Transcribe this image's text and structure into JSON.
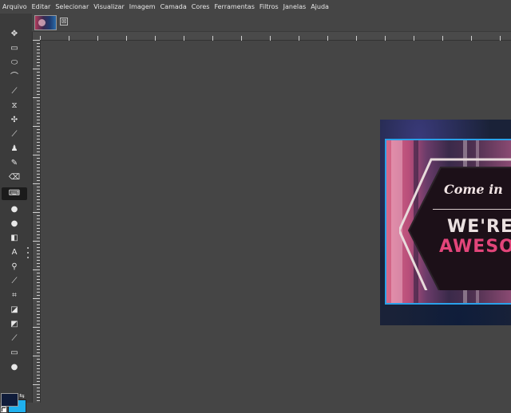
{
  "menubar": {
    "items": [
      "Arquivo",
      "Editar",
      "Selecionar",
      "Visualizar",
      "Imagem",
      "Camada",
      "Cores",
      "Ferramentas",
      "Filtros",
      "Janelas",
      "Ajuda"
    ]
  },
  "toolbox": {
    "tools": [
      {
        "name": "move-tool",
        "icon": "move-icon",
        "glyph": "✥"
      },
      {
        "name": "rect-select-tool",
        "icon": "rectangle-select-icon",
        "glyph": "▭"
      },
      {
        "name": "ellipse-select-tool",
        "icon": "ellipse-select-icon",
        "glyph": "⬭"
      },
      {
        "name": "free-select-tool",
        "icon": "lasso-icon",
        "glyph": "⌒"
      },
      {
        "name": "fuzzy-select-tool",
        "icon": "magic-wand-icon",
        "glyph": "⟋"
      },
      {
        "name": "transform-tool",
        "icon": "unified-transform-icon",
        "glyph": "⧖"
      },
      {
        "name": "warp-tool",
        "icon": "warp-transform-icon",
        "glyph": "✣"
      },
      {
        "name": "paintbrush-tool",
        "icon": "paintbrush-icon",
        "glyph": "⟋"
      },
      {
        "name": "clone-tool",
        "icon": "clone-stamp-icon",
        "glyph": "♟"
      },
      {
        "name": "pencil-tool",
        "icon": "pencil-icon",
        "glyph": "✎"
      },
      {
        "name": "eraser-tool",
        "icon": "eraser-icon",
        "glyph": "⌫"
      },
      {
        "name": "text-tool-active",
        "icon": "keyboard-icon",
        "glyph": "⌨",
        "active": true
      },
      {
        "name": "blur-tool",
        "icon": "drop-icon",
        "glyph": "●"
      },
      {
        "name": "dodge-tool",
        "icon": "dodge-burn-icon",
        "glyph": "●"
      },
      {
        "name": "bucket-fill-tool",
        "icon": "bucket-fill-icon",
        "glyph": "◧"
      },
      {
        "name": "text-tool",
        "icon": "text-icon",
        "glyph": "A"
      },
      {
        "name": "zoom-tool",
        "icon": "zoom-icon",
        "glyph": "⚲"
      },
      {
        "name": "color-picker-tool",
        "icon": "eyedropper-icon",
        "glyph": "⟋"
      },
      {
        "name": "crop-tool",
        "icon": "crop-icon",
        "glyph": "⌗"
      },
      {
        "name": "paint-select-tool",
        "icon": "paint-select-icon",
        "glyph": "◪"
      },
      {
        "name": "gradient-fill-tool",
        "icon": "fill-icon",
        "glyph": "◩"
      },
      {
        "name": "smudge-tool",
        "icon": "smudge-icon",
        "glyph": "⟋"
      },
      {
        "name": "align-tool",
        "icon": "align-icon",
        "glyph": "▭"
      },
      {
        "name": "speech-tool",
        "icon": "speech-icon",
        "glyph": "●"
      }
    ],
    "foreground_color": "#101c3a",
    "background_color": "#1fb0ee"
  },
  "tab": {
    "close_label": "⊠"
  },
  "image": {
    "accent_bound": "#2aa2ea",
    "sign_line1": "Come in",
    "sign_line2": "WE'RE",
    "sign_line3": "AWESOM"
  }
}
